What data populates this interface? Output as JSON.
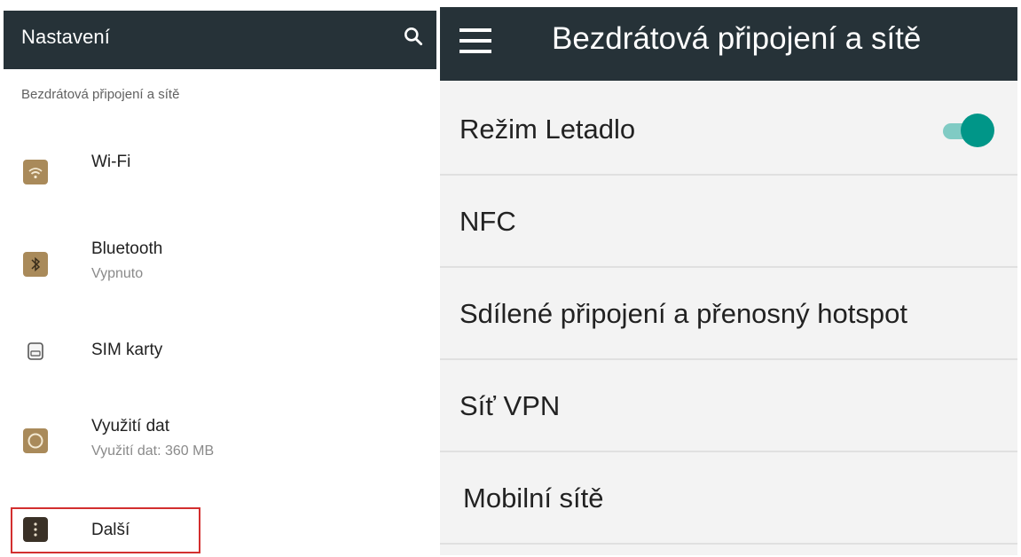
{
  "left": {
    "app_title": "Nastavení",
    "section_header": "Bezdrátová připojení a sítě",
    "items": [
      {
        "title": "Wi-Fi",
        "subtitle": "",
        "icon": "wifi-icon"
      },
      {
        "title": "Bluetooth",
        "subtitle": "Vypnuto",
        "icon": "bluetooth-icon"
      },
      {
        "title": "SIM karty",
        "subtitle": "",
        "icon": "sim-card-icon"
      },
      {
        "title": "Využití dat",
        "subtitle": "Využití dat: 360 MB",
        "icon": "data-usage-icon"
      },
      {
        "title": "Další",
        "subtitle": "",
        "icon": "more-icon"
      }
    ],
    "highlight_color": "#d32f2f"
  },
  "right": {
    "app_title": "Bezdrátová připojení a sítě",
    "items": [
      {
        "label": "Režim Letadlo",
        "toggle_on": true
      },
      {
        "label": "NFC"
      },
      {
        "label": "Sdílené připojení a přenosný hotspot"
      },
      {
        "label": "Síť VPN"
      },
      {
        "label": "Mobilní sítě"
      }
    ]
  },
  "colors": {
    "appbar": "#263238",
    "accent": "#009688",
    "accent_track": "#80cbc4",
    "right_background": "#f3f3f3"
  }
}
